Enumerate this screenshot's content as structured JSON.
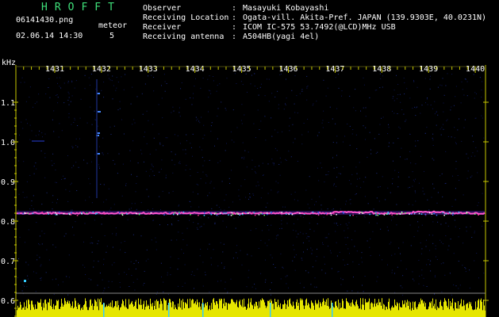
{
  "header": {
    "app_title": "HROFFT",
    "filename": "06141430.png",
    "date_time": "02.06.14 14:30",
    "meteor_label": "meteor",
    "meteor_count": "5"
  },
  "meta": [
    {
      "key": "Observer",
      "value": "Masayuki Kobayashi"
    },
    {
      "key": "Receiving Location",
      "value": "Ogata-vill. Akita-Pref. JAPAN (139.9303E, 40.0231N)"
    },
    {
      "key": "Receiver",
      "value": "ICOM IC-575 53.7492(@LCD)MHz USB"
    },
    {
      "key": "Receiving antenna",
      "value": "A504HB(yagi 4el)"
    }
  ],
  "spectrogram": {
    "freq_unit": "kHz",
    "freq_ticks": [
      "1.1",
      "1.0",
      "0.9",
      "0.8",
      "0.7",
      "0.6"
    ],
    "time_ticks": [
      "1431",
      "1432",
      "1433",
      "1434",
      "1435",
      "1436",
      "1437",
      "1438",
      "1439",
      "1440"
    ],
    "colors": {
      "background": "#000000",
      "axis": "#c8c800",
      "trace": "#ff55cc",
      "bottom_noise": "#e6e600"
    }
  }
}
